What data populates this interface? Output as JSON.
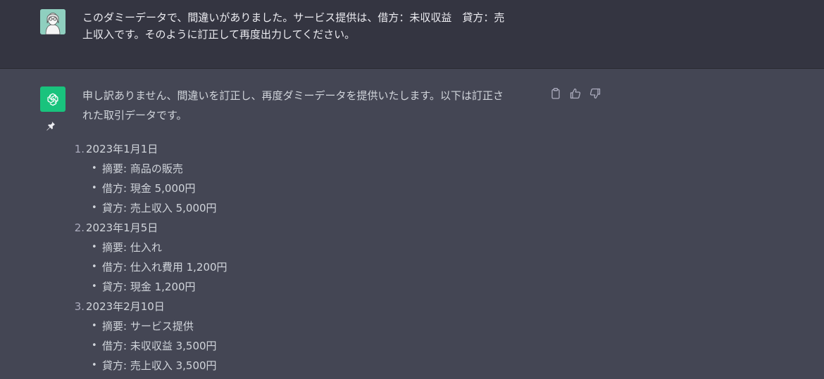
{
  "user_message": {
    "line1": "このダミーデータで、間違いがありました。サービス提供は、借方：未収収益　貸方：売",
    "line2": "上収入です。そのように訂正して再度出力してください。"
  },
  "assistant_message": {
    "intro_line1": "申し訳ありません、間違いを訂正し、再度ダミーデータを提供いたします。以下は訂正さ",
    "intro_line2": "れた取引データです。",
    "transactions": [
      {
        "number": "1.",
        "date": "2023年1月1日",
        "details": [
          "摘要: 商品の販売",
          "借方: 現金 5,000円",
          "貸方: 売上収入 5,000円"
        ]
      },
      {
        "number": "2.",
        "date": "2023年1月5日",
        "details": [
          "摘要: 仕入れ",
          "借方: 仕入れ費用 1,200円",
          "貸方: 現金 1,200円"
        ]
      },
      {
        "number": "3.",
        "date": "2023年2月10日",
        "details": [
          "摘要: サービス提供",
          "借方: 未収収益 3,500円",
          "貸方: 売上収入 3,500円"
        ]
      }
    ]
  },
  "icons": {
    "user_avatar": "user-avatar-icon",
    "bot_avatar": "openai-logo-icon",
    "pin": "pin-icon",
    "copy": "clipboard-icon",
    "thumbs_up": "thumbs-up-icon",
    "thumbs_down": "thumbs-down-icon"
  },
  "colors": {
    "user_bg": "#343541",
    "assistant_bg": "#444654",
    "bot_accent": "#19c37d"
  }
}
